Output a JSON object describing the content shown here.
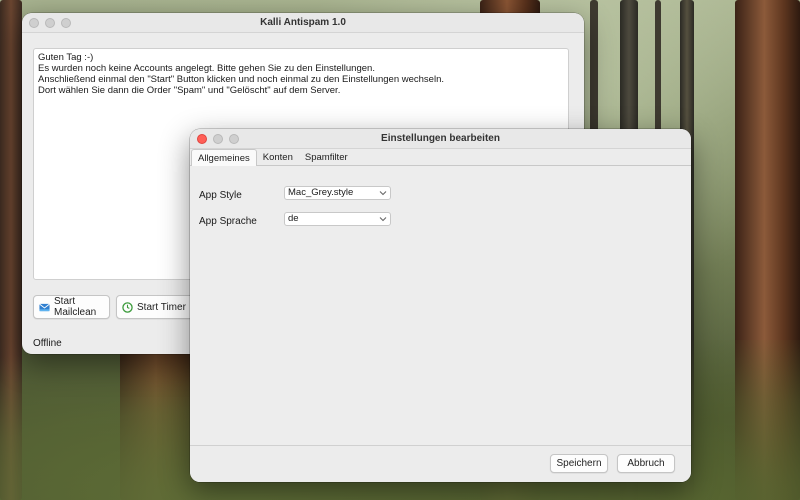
{
  "main_window": {
    "title": "Kalli Antispam 1.0",
    "log_lines": [
      "Guten Tag :-)",
      "Es wurden noch keine Accounts angelegt. Bitte gehen Sie zu den Einstellungen.",
      "Anschließend einmal den \"Start\" Button klicken und noch einmal zu den Einstellungen wechseln.",
      "Dort wählen Sie dann die Order \"Spam\" und \"Gelöscht\" auf dem Server."
    ],
    "buttons": {
      "mailclean": "Start Mailclean",
      "timer": "Start Timer"
    },
    "status": "Offline"
  },
  "settings_window": {
    "title": "Einstellungen bearbeiten",
    "tabs": [
      "Allgemeines",
      "Konten",
      "Spamfilter"
    ],
    "active_tab": "Allgemeines",
    "fields": {
      "app_style": {
        "label": "App Style",
        "value": "Mac_Grey.style"
      },
      "app_language": {
        "label": "App Sprache",
        "value": "de"
      }
    },
    "buttons": {
      "save": "Speichern",
      "cancel": "Abbruch"
    }
  },
  "icons": {
    "mailclean": "mail-clean-icon",
    "timer": "timer-icon",
    "select": "chevron-down-icon"
  },
  "colors": {
    "close_red": "#ff5f57",
    "window_bg": "#ececec",
    "timer_green": "#3a9a3a",
    "mail_blue": "#2f7fd0"
  }
}
